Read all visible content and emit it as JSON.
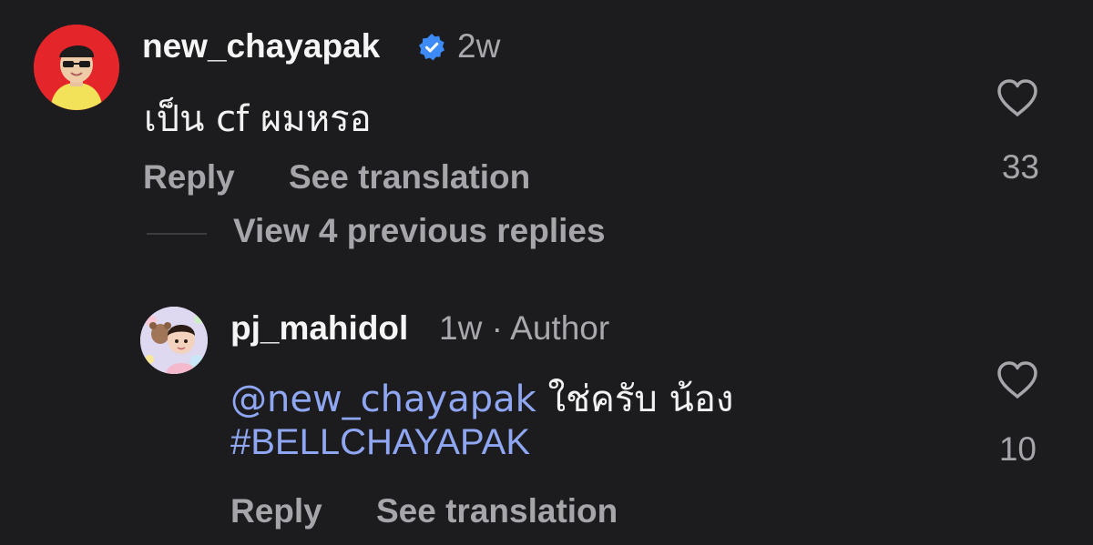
{
  "comments": [
    {
      "username": "new_chayapak",
      "verified": true,
      "time": "2w",
      "text": "เป็น cf ผมหรอ",
      "reply_label": "Reply",
      "translate_label": "See translation",
      "likes": "33"
    }
  ],
  "view_replies_label": "View 4 previous replies",
  "reply": {
    "username": "pj_mahidol",
    "time": "1w",
    "separator": "·",
    "author_label": "Author",
    "mention": "@new_chayapak",
    "text": " ใช่ครับ น้อง",
    "hashtag": "#BELLCHAYAPAK",
    "reply_label": "Reply",
    "translate_label": "See translation",
    "likes": "10"
  },
  "icons": {
    "verified": "verified-badge-icon",
    "like": "heart-outline-icon"
  },
  "colors": {
    "background": "#1c1c1f",
    "link": "#8fa6f2",
    "verified": "#3d8bf7",
    "muted": "#a5a5aa"
  }
}
